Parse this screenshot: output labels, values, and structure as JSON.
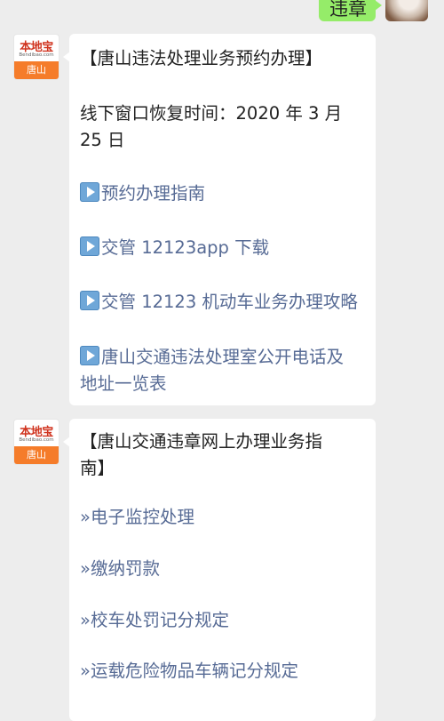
{
  "outgoing": {
    "text": "违章"
  },
  "account": {
    "logo_text": "本地宝",
    "logo_sub": "Bendibao.com",
    "city": "唐山"
  },
  "card1": {
    "title": "【唐山违法处理业务预约办理】",
    "note_line1": "线下窗口恢复时间：2020 年 3 月",
    "note_line2": "25 日",
    "links": [
      "预约办理指南",
      "交管 12123app 下载",
      "交管 12123 机动车业务办理攻略",
      "唐山交通违法处理室公开电话及",
      "地址一览表"
    ]
  },
  "card2": {
    "title_line1": "【唐山交通违章网上办理业务指",
    "title_line2": "南】",
    "bullet": "»",
    "links": [
      "电子监控处理",
      "缴纳罚款",
      "校车处罚记分规定",
      "运载危险物品车辆记分规定"
    ]
  }
}
